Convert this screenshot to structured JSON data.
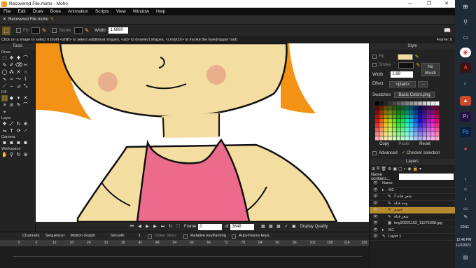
{
  "window": {
    "title": "Recovered File.moho - Moho"
  },
  "menu": [
    "File",
    "Edit",
    "Draw",
    "Bone",
    "Animation",
    "Scripts",
    "View",
    "Window",
    "Help"
  ],
  "doc_tab": {
    "label": "Recovered File.moho"
  },
  "options": {
    "fill_label": "Fill",
    "stroke_label": "Stroke",
    "width_label": "Width:",
    "width_value": "1.6880"
  },
  "status": {
    "text": "Click on a shape to select it (hold <shift> to select additional shapes, <alt> to deselect shapes, <cmd/ctrl> to invoke the Eyedropper tool)",
    "frame": "Frame: 0"
  },
  "tools": {
    "title": "Tools",
    "groups": [
      "Draw",
      "Fill",
      "Layer",
      "Camera",
      "Workspace"
    ]
  },
  "canvas_bar": {
    "frame_label": "Frame",
    "frame_value": "0",
    "of_label": "of",
    "frame_total": "3648",
    "display_quality": "Display Quality"
  },
  "style": {
    "title": "Style",
    "fill_label": "Fill",
    "stroke_label": "Stroke",
    "width_label": "Width",
    "width_value": "1.69",
    "no_brush": "No Brush",
    "effect_label": "Effect",
    "effect_value": "<plain>",
    "swatches_label": "Swatches",
    "swatches_value": "Basic Colors.png",
    "copy": "Copy",
    "paste": "Paste",
    "reset": "Reset",
    "advanced": "Advanced",
    "checker": "Checker selection",
    "fill_color": "#f3dda0",
    "stroke_color": "#111111"
  },
  "layers": {
    "title": "Layers",
    "search_placeholder": "Name contains...",
    "name_header": "Name",
    "items": [
      {
        "name": "M2",
        "indent": 0,
        "selected": false,
        "kind": "group"
      },
      {
        "name": "شعر فتاة 2",
        "indent": 1,
        "selected": false,
        "kind": "bone"
      },
      {
        "name": "وجه فتاة",
        "indent": 1,
        "selected": false,
        "kind": "bone"
      },
      {
        "name": "جسم",
        "indent": 1,
        "selected": true,
        "kind": "vector"
      },
      {
        "name": "شعر فتاة",
        "indent": 1,
        "selected": false,
        "kind": "vector"
      },
      {
        "name": "img20221102_11575398.jpg",
        "indent": 1,
        "selected": false,
        "kind": "image"
      },
      {
        "name": "M1",
        "indent": 0,
        "selected": false,
        "kind": "group"
      },
      {
        "name": "Layer 1",
        "indent": 0,
        "selected": false,
        "kind": "vector"
      }
    ]
  },
  "timeline": {
    "tabs": [
      "Channels",
      "Sequencer",
      "Motion Graph"
    ],
    "interp": "Smooth",
    "interp_step": "1",
    "onion": "Onion Skins",
    "relative": "Relative keyframing",
    "autofreeze": "Auto-freeze keys",
    "ruler": [
      "0",
      "6",
      "12",
      "18",
      "24",
      "30",
      "36",
      "42",
      "48",
      "54",
      "60",
      "66",
      "72",
      "78",
      "84",
      "90",
      "96",
      "102",
      "108",
      "114",
      "120"
    ]
  },
  "taskbar": {
    "lang": "ENG",
    "time": "12:46 PM",
    "date": "11/2/2022"
  }
}
